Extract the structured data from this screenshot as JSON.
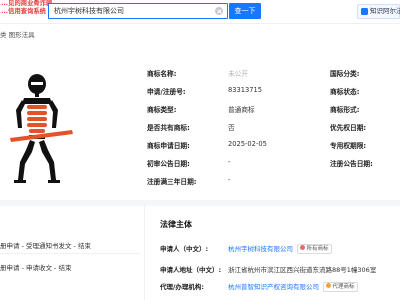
{
  "topbar": {
    "notice_lines": [
      "...见的商业骨诈骗",
      "...信用查询系统"
    ],
    "search_value": "杭州宇树科技有限公司",
    "search_button": "查一下",
    "zhiqing_label": "知识阿尔法"
  },
  "breadcrumb": "类  图形法具",
  "trademark": {
    "rows": [
      {
        "label": "商标名称:",
        "value": "未公开",
        "muted": true,
        "label2": "国际分类:"
      },
      {
        "label": "申请/注册号:",
        "value": "83313715",
        "muted": false,
        "label2": "商标状态:"
      },
      {
        "label": "商标类型:",
        "value": "普通商标",
        "muted": false,
        "label2": "商标形式:"
      },
      {
        "label": "是否共有商标:",
        "value": "否",
        "muted": false,
        "label2": "优先权日期:"
      },
      {
        "label": "商标申请日期:",
        "value": "2025-02-05",
        "muted": false,
        "label2": "专用权期限:"
      },
      {
        "label": "初审公告日期:",
        "value": "-",
        "muted": false,
        "label2": "注册公告日期:"
      },
      {
        "label": "注册满三年日期:",
        "value": "-",
        "muted": false,
        "label2": ""
      }
    ]
  },
  "flow": {
    "items": [
      "册申请 - 受理通知书发文 - 结束",
      "册申请 - 申请收文 - 结束"
    ]
  },
  "legal": {
    "title": "法律主体",
    "rows": [
      {
        "label": "申请人（中文）:",
        "value": "杭州宇树科技有限公司",
        "link": true,
        "tag": "所有商标",
        "tag_color": "#e36b6b"
      },
      {
        "label": "申请人地址（中文）:",
        "value": "浙江省杭州市滨江区西兴街道东流路88号1幢306室",
        "link": false,
        "tag": "",
        "tag_color": ""
      },
      {
        "label": "代理/办理机构:",
        "value": "杭州普智知识产权咨询有限公司",
        "link": true,
        "tag": "代理商标",
        "tag_color": "#f0a33a"
      }
    ]
  },
  "colors": {
    "accent": "#1677ff",
    "logo_orange": "#e2532a",
    "logo_black": "#111111"
  }
}
